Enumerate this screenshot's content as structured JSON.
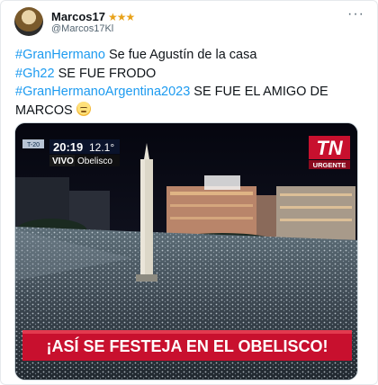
{
  "post": {
    "display_name": "Marcos17",
    "badge_stars": "★★★",
    "handle": "@Marcos17Kl",
    "more_icon": "more-dots-icon",
    "lines": [
      {
        "hashtag": "#GranHermano",
        "text": " Se fue Agustín de la casa"
      },
      {
        "hashtag": "#Gh22",
        "text": " SE FUE FRODO"
      },
      {
        "hashtag": "#GranHermanoArgentina2023",
        "text": " SE FUE EL AMIGO DE"
      },
      {
        "hashtag": "",
        "text": "MARCOS"
      }
    ],
    "emoji": "face-with-rolling-eyes"
  },
  "media": {
    "broadcast": {
      "clock": "20:19",
      "temperature": "12.1°",
      "live_label": "VIVO",
      "location": "Obelisco",
      "side_code": "T-20",
      "channel_logo": "TN",
      "channel_tag": "URGENTE",
      "headline": "¡ASÍ SE FESTEJA EN EL OBELISCO!"
    },
    "colors": {
      "banner_red": "#c8102e",
      "hashtag_blue": "#1d9bf0"
    }
  }
}
